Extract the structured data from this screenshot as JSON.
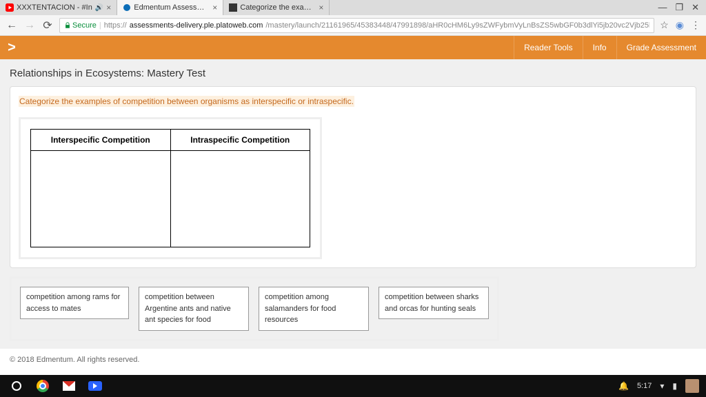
{
  "browser": {
    "tabs": [
      {
        "title": "XXXTENTACION - #In",
        "active": false,
        "hasAudio": true
      },
      {
        "title": "Edmentum Assessment",
        "active": true,
        "hasAudio": false
      },
      {
        "title": "Categorize the example",
        "active": false,
        "hasAudio": false
      }
    ],
    "secure_label": "Secure",
    "url_domain": "assessments-delivery.ple.platoweb.com",
    "url_path": "/mastery/launch/21161965/45383448/47991898/aHR0cHM6Ly9sZWFybmVyLnBsZS5wbGF0b3dlYi5jb20vc2Vjb25kYXJ5L2..."
  },
  "header": {
    "next_symbol": ">",
    "links": {
      "reader": "Reader Tools",
      "info": "Info",
      "grade": "Grade Assessment"
    }
  },
  "page": {
    "title": "Relationships in Ecosystems: Mastery Test",
    "question": "Categorize the examples of competition between organisms as interspecific or intraspecific.",
    "columns": {
      "left": "Interspecific Competition",
      "right": "Intraspecific Competition"
    },
    "tiles": [
      "competition among rams for access to mates",
      "competition between Argentine ants and native ant species for food",
      "competition among salamanders for food resources",
      "competition between sharks and orcas for hunting seals"
    ],
    "footer": "© 2018 Edmentum. All rights reserved."
  },
  "taskbar": {
    "time": "5:17"
  }
}
